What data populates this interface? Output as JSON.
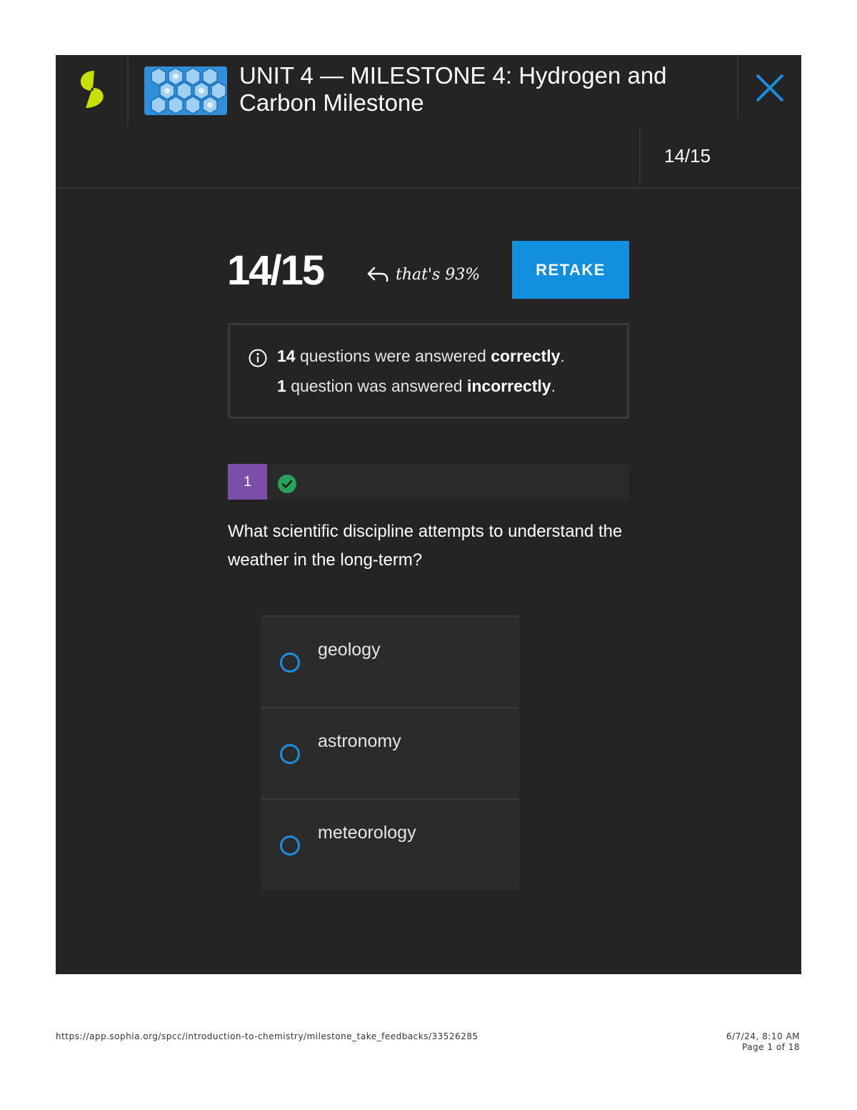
{
  "header": {
    "title": "UNIT 4 — MILESTONE 4: Hydrogen and Carbon Milestone",
    "logo_icon": "sophia-logo-icon",
    "close_icon": "close-icon"
  },
  "subbar": {
    "score": "14/15"
  },
  "result": {
    "score": "14/15",
    "percent_note": "that's 93%",
    "retake_label": "RETAKE"
  },
  "summary": {
    "correct_count": "14",
    "correct_text": "questions were answered",
    "correct_word": "correctly",
    "incorrect_count": "1",
    "incorrect_text": "question was answered",
    "incorrect_word": "incorrectly",
    "period": "."
  },
  "question": {
    "number": "1",
    "status": "correct",
    "text": "What scientific discipline attempts to understand the weather in the long-term?",
    "options": [
      {
        "label": "geology"
      },
      {
        "label": "astronomy"
      },
      {
        "label": "meteorology"
      }
    ]
  },
  "footer": {
    "url": "https://app.sophia.org/spcc/introduction-to-chemistry/milestone_take_feedbacks/33526285",
    "datetime": "6/7/24, 8:10 AM",
    "page": "Page 1 of 18"
  },
  "colors": {
    "background": "#242424",
    "accent_blue": "#138fe0",
    "question_badge": "#7b4fa8",
    "correct_green": "#27a25a",
    "logo_green": "#c8e000"
  }
}
